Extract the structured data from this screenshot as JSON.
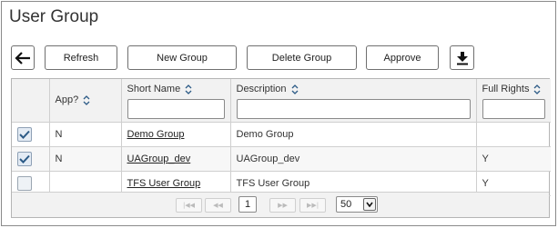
{
  "page": {
    "title": "User Group"
  },
  "toolbar": {
    "back_icon": "arrow-left-icon",
    "refresh_label": "Refresh",
    "new_group_label": "New Group",
    "delete_group_label": "Delete Group",
    "approve_label": "Approve",
    "download_icon": "download-icon"
  },
  "table": {
    "columns": [
      {
        "label": "",
        "sortable": false
      },
      {
        "label": "App?",
        "sortable": true
      },
      {
        "label": "Short Name",
        "sortable": true,
        "filter": ""
      },
      {
        "label": "Description",
        "sortable": true,
        "filter": ""
      },
      {
        "label": "Full Rights",
        "sortable": true,
        "filter": ""
      }
    ],
    "rows": [
      {
        "checked": true,
        "app": "N",
        "short_name": "Demo Group",
        "description": "Demo Group",
        "full_rights": ""
      },
      {
        "checked": true,
        "app": "N",
        "short_name": "UAGroup_dev",
        "description": "UAGroup_dev",
        "full_rights": "Y"
      },
      {
        "checked": false,
        "app": "",
        "short_name": "TFS User Group",
        "description": "TFS User Group",
        "full_rights": "Y"
      }
    ]
  },
  "pager": {
    "first": "|◀◀",
    "prev": "◀◀",
    "current_page": "1",
    "next": "▶▶",
    "last": "▶▶|",
    "page_size": "50"
  },
  "colors": {
    "check": "#2b5a86",
    "border": "#6f6f6f",
    "header_bg": "#f2f2f2"
  }
}
